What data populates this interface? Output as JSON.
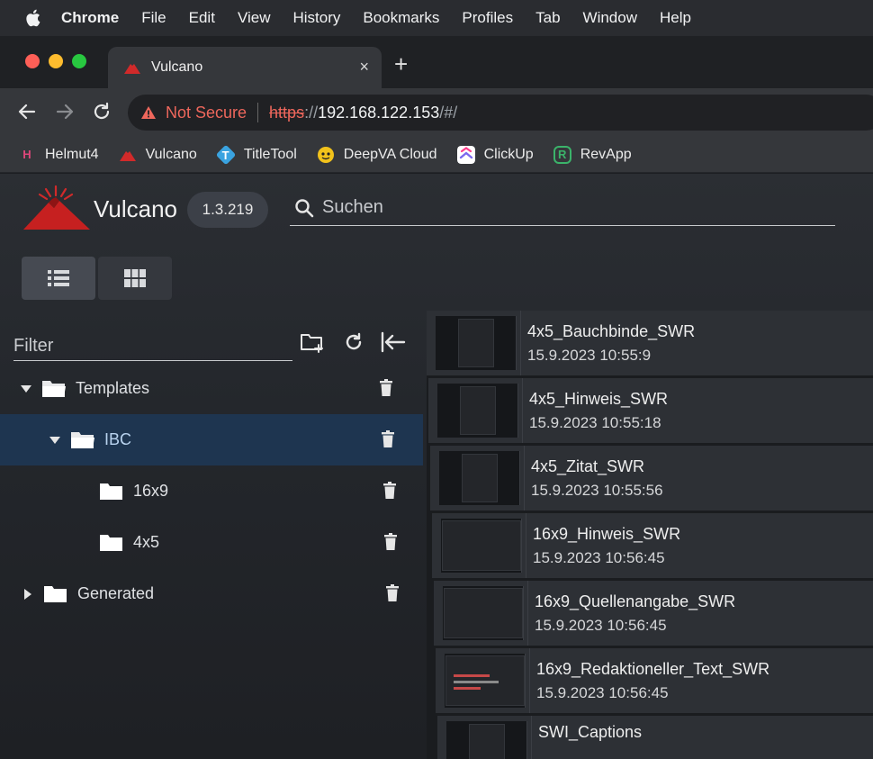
{
  "menubar": {
    "items": [
      "Chrome",
      "File",
      "Edit",
      "View",
      "History",
      "Bookmarks",
      "Profiles",
      "Tab",
      "Window",
      "Help"
    ]
  },
  "tab": {
    "title": "Vulcano",
    "close": "×"
  },
  "newtab": "+",
  "omnibox": {
    "security": "Not Secure",
    "scheme": "https",
    "slashes": "://",
    "host": "192.168.122.153",
    "path": "/#/"
  },
  "bookmarks": [
    {
      "label": "Helmut4",
      "icon": "H",
      "color": "#e0477b"
    },
    {
      "label": "Vulcano",
      "icon": "volcano-icon",
      "color": "#d12a2a"
    },
    {
      "label": "TitleTool",
      "icon": "T",
      "color": "#3aa3e0"
    },
    {
      "label": "DeepVA Cloud",
      "icon": "deepva-icon",
      "color": "#f2c21b"
    },
    {
      "label": "ClickUp",
      "icon": "clickup-icon",
      "color": "#7b68ee"
    },
    {
      "label": "RevApp",
      "icon": "R",
      "color": "#3bb36a"
    }
  ],
  "app": {
    "name": "Vulcano",
    "version": "1.3.219",
    "search_placeholder": "Suchen",
    "filter_placeholder": "Filter",
    "accent": "#1e3550"
  },
  "tree": [
    {
      "label": "Templates",
      "level": 0,
      "expanded": true,
      "selected": false,
      "caret": "down"
    },
    {
      "label": "IBC",
      "level": 1,
      "expanded": true,
      "selected": true,
      "caret": "down"
    },
    {
      "label": "16x9",
      "level": 2,
      "expanded": false,
      "selected": false,
      "caret": "none"
    },
    {
      "label": "4x5",
      "level": 2,
      "expanded": false,
      "selected": false,
      "caret": "none"
    },
    {
      "label": "Generated",
      "level": 0,
      "expanded": false,
      "selected": false,
      "caret": "right"
    }
  ],
  "templates": [
    {
      "name": "4x5_Bauchbinde_SWR",
      "date": "15.9.2023 10:55:9",
      "format": "4x5"
    },
    {
      "name": "4x5_Hinweis_SWR",
      "date": "15.9.2023 10:55:18",
      "format": "4x5"
    },
    {
      "name": "4x5_Zitat_SWR",
      "date": "15.9.2023 10:55:56",
      "format": "4x5"
    },
    {
      "name": "16x9_Hinweis_SWR",
      "date": "15.9.2023 10:56:45",
      "format": "16x9"
    },
    {
      "name": "16x9_Quellenangabe_SWR",
      "date": "15.9.2023 10:56:45",
      "format": "16x9"
    },
    {
      "name": "16x9_Redaktioneller_Text_SWR",
      "date": "15.9.2023 10:56:45",
      "format": "16x9"
    },
    {
      "name": "SWI_Captions",
      "date": "",
      "format": "4x5"
    }
  ]
}
